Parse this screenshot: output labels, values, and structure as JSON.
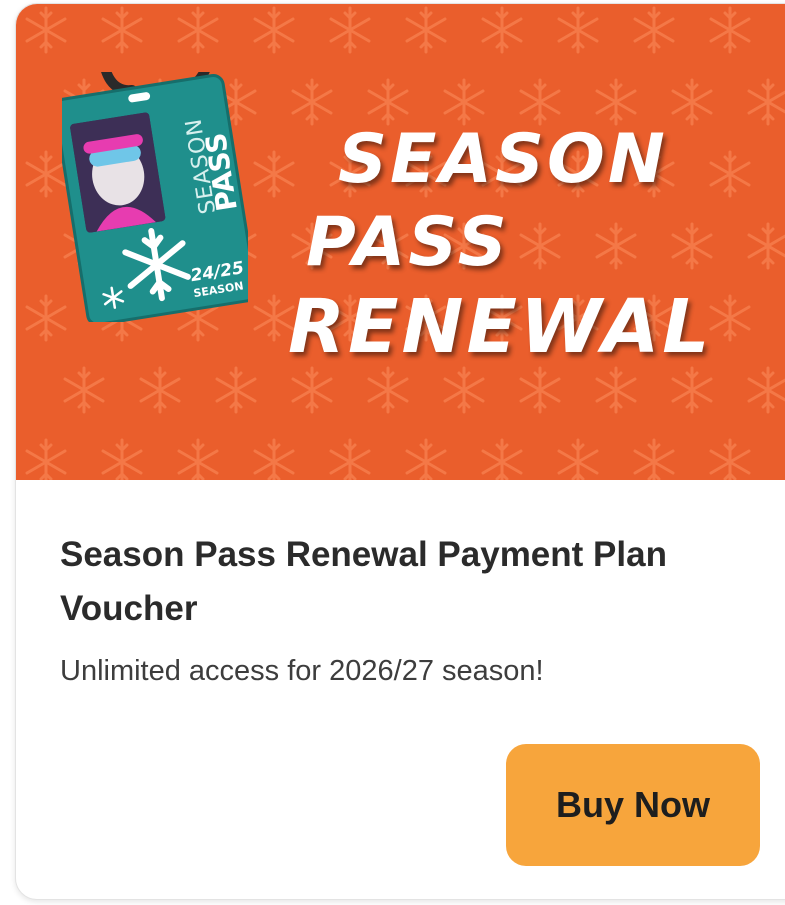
{
  "banner": {
    "line1": "SEASON",
    "line2": "PASS",
    "line3": "RENEWAL",
    "pass_card": {
      "label_top": "SEASON",
      "label_bottom": "PASS",
      "season_number": "24/25",
      "season_word": "SEASON"
    },
    "background_color": "#ea5e2c"
  },
  "product": {
    "title": "Season Pass Renewal Payment Plan Voucher",
    "subtitle": "Unlimited access for 2026/27 season!"
  },
  "actions": {
    "buy_label": "Buy Now",
    "buy_color": "#f7a53c"
  },
  "icons": {
    "banner_pattern": "snowflake-icon",
    "pass_snowflake": "snowflake-icon"
  }
}
